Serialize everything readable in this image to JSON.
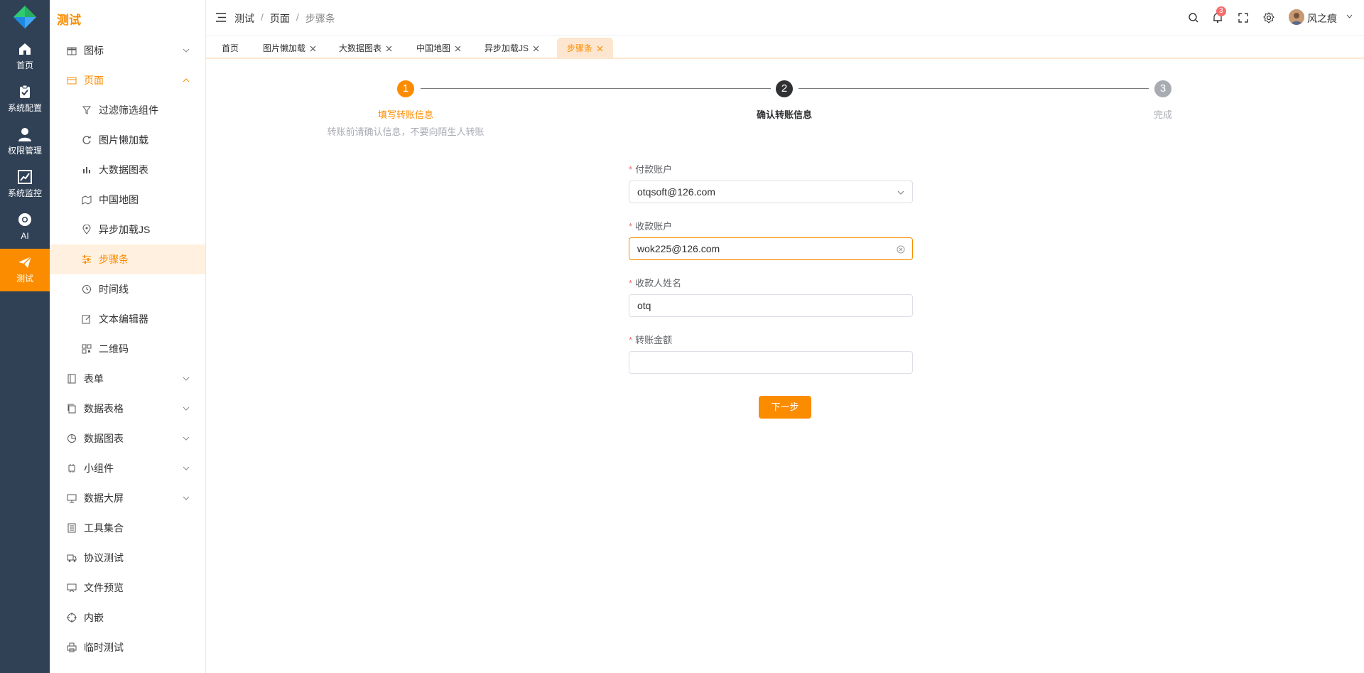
{
  "rail": {
    "items": [
      {
        "label": "首页",
        "icon": "home-icon"
      },
      {
        "label": "系统配置",
        "icon": "clipboard-icon"
      },
      {
        "label": "权限管理",
        "icon": "user-icon"
      },
      {
        "label": "系统监控",
        "icon": "chart-line-icon"
      },
      {
        "label": "AI",
        "icon": "chrome-icon"
      },
      {
        "label": "测试",
        "icon": "paper-plane-icon",
        "active": true
      }
    ]
  },
  "menu": {
    "title": "测试",
    "items": [
      {
        "label": "图标",
        "icon": "gift-icon",
        "expandable": true
      },
      {
        "label": "页面",
        "icon": "folder-icon",
        "expandable": true,
        "open": true
      },
      {
        "label": "过滤筛选组件",
        "icon": "filter-icon",
        "sub": true
      },
      {
        "label": "图片懒加载",
        "icon": "refresh-icon",
        "sub": true
      },
      {
        "label": "大数据图表",
        "icon": "bar-chart-icon",
        "sub": true
      },
      {
        "label": "中国地图",
        "icon": "map-icon",
        "sub": true
      },
      {
        "label": "异步加载JS",
        "icon": "location-icon",
        "sub": true
      },
      {
        "label": "步骤条",
        "icon": "sliders-icon",
        "sub": true,
        "selected": true
      },
      {
        "label": "时间线",
        "icon": "clock-icon",
        "sub": true
      },
      {
        "label": "文本编辑器",
        "icon": "edit-icon",
        "sub": true
      },
      {
        "label": "二维码",
        "icon": "qrcode-icon",
        "sub": true
      },
      {
        "label": "表单",
        "icon": "notebook-icon",
        "expandable": true
      },
      {
        "label": "数据表格",
        "icon": "copy-icon",
        "expandable": true
      },
      {
        "label": "数据图表",
        "icon": "pie-chart-icon",
        "expandable": true
      },
      {
        "label": "小组件",
        "icon": "cpu-icon",
        "expandable": true
      },
      {
        "label": "数据大屏",
        "icon": "monitor-icon",
        "expandable": true
      },
      {
        "label": "工具集合",
        "icon": "document-icon"
      },
      {
        "label": "协议测试",
        "icon": "truck-icon"
      },
      {
        "label": "文件预览",
        "icon": "presentation-icon"
      },
      {
        "label": "内嵌",
        "icon": "aim-icon"
      },
      {
        "label": "临时测试",
        "icon": "printer-icon"
      }
    ]
  },
  "header": {
    "breadcrumb": [
      "测试",
      "页面",
      "步骤条"
    ],
    "notification_count": "3",
    "username": "风之痕"
  },
  "tabs": [
    {
      "label": "首页",
      "closable": false
    },
    {
      "label": "图片懒加载",
      "closable": true
    },
    {
      "label": "大数据图表",
      "closable": true
    },
    {
      "label": "中国地图",
      "closable": true
    },
    {
      "label": "异步加载JS",
      "closable": true
    },
    {
      "label": "步骤条",
      "closable": true,
      "active": true
    }
  ],
  "steps": [
    {
      "num": "1",
      "title": "填写转账信息",
      "desc": "转账前请确认信息，不要向陌生人转账",
      "state": "finished"
    },
    {
      "num": "2",
      "title": "确认转账信息",
      "desc": "",
      "state": "process"
    },
    {
      "num": "3",
      "title": "完成",
      "desc": "",
      "state": "wait"
    }
  ],
  "form": {
    "payer_label": "付款账户",
    "payer_value": "otqsoft@126.com",
    "payee_label": "收款账户",
    "payee_value": "wok225@126.com",
    "name_label": "收款人姓名",
    "name_value": "otq",
    "amount_label": "转账金额",
    "amount_value": "",
    "next_button": "下一步"
  },
  "colors": {
    "accent": "#fb8c00",
    "rail": "#304156",
    "process": "#303133",
    "wait": "#a8abb2"
  }
}
